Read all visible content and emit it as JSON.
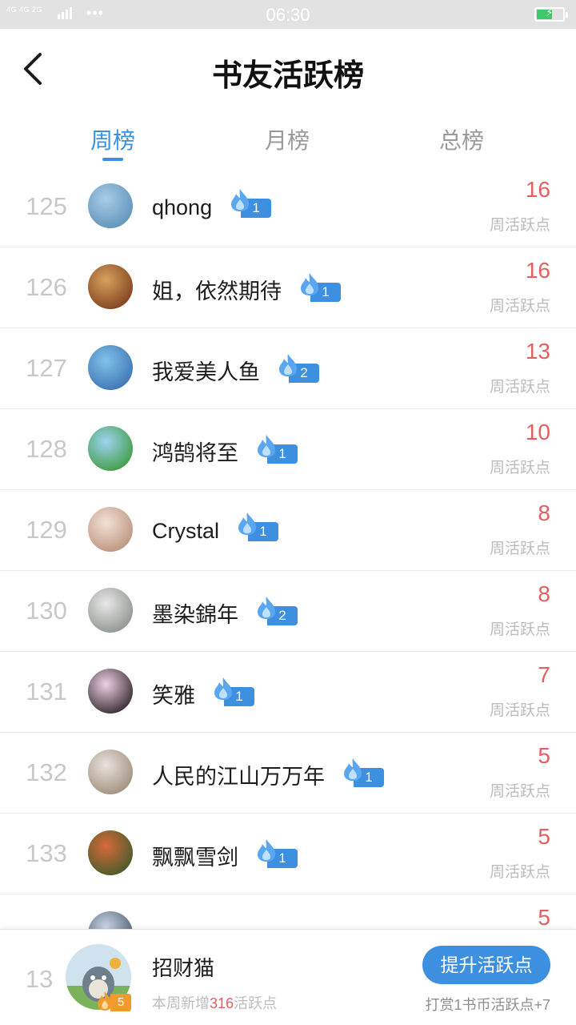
{
  "status_bar": {
    "signal_text": "4G 4G 2G",
    "time": "06:30",
    "battery_level": 0.6,
    "battery_color": "#3ec86c"
  },
  "header": {
    "title": "书友活跃榜",
    "back_icon": "chevron-left-icon"
  },
  "tabs": [
    {
      "label": "周榜",
      "active": true
    },
    {
      "label": "月榜",
      "active": false
    },
    {
      "label": "总榜",
      "active": false
    }
  ],
  "colors": {
    "accent": "#3d8fe0",
    "score": "#e46060",
    "muted": "#bcbcbc",
    "my_badge": "#f39a2c"
  },
  "list": [
    {
      "rank": "125",
      "name": "qhong",
      "level": "1",
      "score": "16",
      "score_label": "周活跃点",
      "avatar": [
        "#a9cde6",
        "#5b8fb8"
      ]
    },
    {
      "rank": "126",
      "name": "姐，依然期待",
      "level": "1",
      "score": "16",
      "score_label": "周活跃点",
      "avatar": [
        "#d7a25c",
        "#7b3b1c"
      ]
    },
    {
      "rank": "127",
      "name": "我爱美人鱼",
      "level": "2",
      "score": "13",
      "score_label": "周活跃点",
      "avatar": [
        "#7ec3ea",
        "#3c6fb0"
      ]
    },
    {
      "rank": "128",
      "name": "鸿鹄将至",
      "level": "1",
      "score": "10",
      "score_label": "周活跃点",
      "avatar": [
        "#9fd3f2",
        "#3a9a3a"
      ]
    },
    {
      "rank": "129",
      "name": "Crystal",
      "level": "1",
      "score": "8",
      "score_label": "周活跃点",
      "avatar": [
        "#f3e1d4",
        "#b8907a"
      ]
    },
    {
      "rank": "130",
      "name": "墨染錦年",
      "level": "2",
      "score": "8",
      "score_label": "周活跃点",
      "avatar": [
        "#e8e8e8",
        "#8a8f8a"
      ]
    },
    {
      "rank": "131",
      "name": "笑雅",
      "level": "1",
      "score": "7",
      "score_label": "周活跃点",
      "avatar": [
        "#f0d0e4",
        "#2a2226"
      ]
    },
    {
      "rank": "132",
      "name": "人民的江山万万年",
      "level": "1",
      "score": "5",
      "score_label": "周活跃点",
      "avatar": [
        "#e9e3dc",
        "#9c8a78"
      ]
    },
    {
      "rank": "133",
      "name": "飘飘雪剑",
      "level": "1",
      "score": "5",
      "score_label": "周活跃点",
      "avatar": [
        "#d86a3a",
        "#3f5a2a"
      ]
    },
    {
      "rank": "",
      "name": "",
      "level": "",
      "score": "5",
      "score_label": "",
      "avatar": [
        "#c8d6e6",
        "#44546a"
      ]
    }
  ],
  "me": {
    "rank": "13",
    "name": "招财猫",
    "level": "5",
    "sub_prefix": "本周新增",
    "sub_value": "316",
    "sub_suffix": "活跃点",
    "boost_button": "提升活跃点",
    "reward_tip": "打赏1书币活跃点+7"
  }
}
